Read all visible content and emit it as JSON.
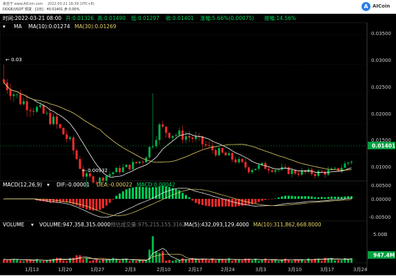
{
  "header": {
    "source_line": "来自于 www.AICoin.com　 2022-03-21 18:39 (UTC+8)",
    "symbol_line": "DOGE/USDT 现货 · [1日] · ¥0.01401 步:0.00%",
    "logo_label": "AICoin",
    "logo_icon": "aicoin-logo-icon"
  },
  "info_bar": {
    "time": "时间:2022-03-21 08:00",
    "open": "开:0.01326",
    "high": "高:0.01490",
    "low": "低:0.01297",
    "close": "收:0.01401",
    "change": "涨幅:5.66%(0.00075)",
    "amplitude": "振幅:14.56%"
  },
  "ma_legend": {
    "name": "MA",
    "ma10": "MA(10):0.01274",
    "ma30": "MA(30):0.01269"
  },
  "annotations": {
    "high_marker": "← 0.03",
    "low_marker": "← 0.00932",
    "current_price": "0.01401"
  },
  "macd_legend": {
    "name": "MACD(12,26,9)",
    "dif": "DIF:-0.00001",
    "dea": "DEA:-0.00022",
    "macd": "MACD:0.00042"
  },
  "volume_legend": {
    "name": "VOLUME",
    "volume": "VOLUME:947,358,315.0000",
    "est": "预估成交量:975,215,155.3162",
    "ma5": "MA(5):432,093,129.4000",
    "ma10": "MA(10):311,862,668.8000"
  },
  "price_axis": [
    "0.03500",
    "0.03000",
    "0.02500",
    "0.02000",
    "0.01500",
    "0.01000"
  ],
  "macd_axis": [
    "0.00500",
    "0.00000",
    "-0.00500"
  ],
  "volume_axis": {
    "top": "5.00B",
    "current": "947.4M"
  },
  "date_axis": [
    "1月13",
    "1月20",
    "1月27",
    "2月3",
    "2月10",
    "2月17",
    "2月24",
    "3月3",
    "3月10",
    "3月17",
    "3月24"
  ],
  "colors": {
    "up": "#00b34a",
    "down": "#ff2b2b",
    "ma10": "#ffffff",
    "ma30": "#e6d36a",
    "dif": "#ffffff",
    "dea": "#e6d36a",
    "macd": "#00d35a",
    "vol_ma": "#e6d36a",
    "price_tag": "#00a040",
    "dark_bg": "#000000"
  }
}
